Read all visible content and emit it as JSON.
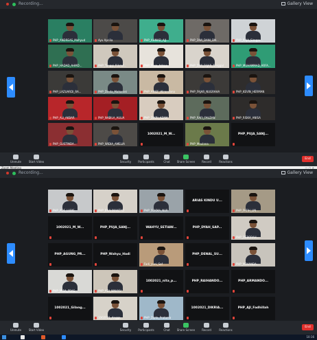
{
  "window_top": {
    "recording_label": "Recording...",
    "view_label": "Gallery View",
    "tiles": [
      {
        "name": "PHP_ANDREAS_Mahyud",
        "kind": "video",
        "bg": "#2a7f62"
      },
      {
        "name": "Ayu Aprilia",
        "kind": "video",
        "bg": "#4c4a48"
      },
      {
        "name": "PHP_AHMAD_AJJ...",
        "kind": "video",
        "bg": "#3fae8d"
      },
      {
        "name": "PHP_DWI_DANI_DN...",
        "kind": "video",
        "bg": "#6e6a66"
      },
      {
        "name": "PHP_RAJA_Siregar...",
        "kind": "video",
        "bg": "#cfd3d6"
      },
      {
        "name": "PHP_HADAD_AHMD...",
        "kind": "video",
        "bg": "#2f6f52"
      },
      {
        "name": "PHP_Tunggi_Rikmd...",
        "kind": "video",
        "bg": "#cfc8bd"
      },
      {
        "name": "PHP_Resa_Adnan",
        "kind": "video",
        "bg": "#e7e3dc"
      },
      {
        "name": "PHP_DWI_FAJAR_Tanggal",
        "kind": "video",
        "bg": "#d9d4cc"
      },
      {
        "name": "PHP_MUHAMMAD_ARFA...",
        "kind": "video",
        "bg": "#2f9c75"
      },
      {
        "name": "PHP_LAZUARDI_RA...",
        "kind": "video",
        "bg": "#3b3a38"
      },
      {
        "name": "PHP_Dinda_Maharani",
        "kind": "video",
        "bg": "#7a8a86"
      },
      {
        "name": "PHP_ARIEF_Wirandana",
        "kind": "video",
        "bg": "#c9b9a3"
      },
      {
        "name": "PHP_FAJAR_NUGRAHA",
        "kind": "video",
        "bg": "#3c3a38"
      },
      {
        "name": "PHP_KEVIN_HERMAN",
        "kind": "video",
        "bg": "#2f2d2c"
      },
      {
        "name": "PHP_ALI_AKBAR",
        "kind": "video",
        "bg": "#b8262a"
      },
      {
        "name": "PHP_NABILA_AULIA",
        "kind": "video",
        "bg": "#a41f24"
      },
      {
        "name": "PHP_DIKRI_AZAM",
        "kind": "video",
        "bg": "#d8ccbf"
      },
      {
        "name": "PHP_RAFI_FAUZAN",
        "kind": "video",
        "bg": "#5d6b5c"
      },
      {
        "name": "PHP_RISKA_ANISA",
        "kind": "video",
        "bg": "#2e2c2b"
      },
      {
        "name": "PHP_GUSTINDA...",
        "kind": "video",
        "bg": "#8b2f32"
      },
      {
        "name": "PHP_WIDIA_AMELIA",
        "kind": "video",
        "bg": "#4d4a47"
      },
      {
        "name": "1002021_M_W...",
        "kind": "name"
      },
      {
        "name": "PHP_Maulana",
        "kind": "video",
        "bg": "#6b7a4a"
      },
      {
        "name": "PHP_PUJA_SANJ...",
        "kind": "name"
      }
    ],
    "toolbar": [
      "Unmute",
      "Start Video",
      "Security",
      "Participants",
      "Chat",
      "Share Screen",
      "Record",
      "Reactions"
    ],
    "end_label": "End"
  },
  "app_title": "Zoom Meeting",
  "window_bottom": {
    "recording_label": "Recording...",
    "view_label": "Gallery View",
    "tiles": [
      {
        "name": "PHP_ADE_LUBIS",
        "kind": "video",
        "bg": "#c7c9cb"
      },
      {
        "name": "PHP_BRAHMANTYO",
        "kind": "video",
        "bg": "#d6d1c9"
      },
      {
        "name": "PHP_SUKMA_NUR",
        "kind": "video",
        "bg": "#9aa3a9"
      },
      {
        "name": "ARIAS KINDU U...",
        "kind": "name"
      },
      {
        "name": "PHP_FATIH_LIN...",
        "kind": "video",
        "bg": "#a59a86"
      },
      {
        "name": "1002021_M_W...",
        "kind": "name"
      },
      {
        "name": "PHP_PUJA_SANJ...",
        "kind": "name"
      },
      {
        "name": "WAHYU_SETIAW...",
        "kind": "name"
      },
      {
        "name": "PHP_DYAH_SAP...",
        "kind": "name"
      },
      {
        "name": "PHP_DEBORAH...",
        "kind": "video",
        "bg": "#d0cbc3"
      },
      {
        "name": "PHP_AGUNG_PR...",
        "kind": "name"
      },
      {
        "name": "PHP_Wahyu_Hadi",
        "kind": "name"
      },
      {
        "name": "Fadi_yuni_Saf",
        "kind": "video",
        "bg": "#b99b7a"
      },
      {
        "name": "PHP_DENAL_SU...",
        "kind": "name"
      },
      {
        "name": "PHP_NOVANDA...",
        "kind": "video",
        "bg": "#c8c4bc"
      },
      {
        "name": "PHP_MIRA_PRAS",
        "kind": "video",
        "bg": "#d9d9d6"
      },
      {
        "name": "PHP_ADI_WAHYU",
        "kind": "video",
        "bg": "#cdc6ba"
      },
      {
        "name": "1002021_nita_p...",
        "kind": "name"
      },
      {
        "name": "PHP_RAIHANDO...",
        "kind": "name"
      },
      {
        "name": "PHP_ARMANDO...",
        "kind": "name"
      },
      {
        "name": "1002021_Gilang...",
        "kind": "name"
      },
      {
        "name": "1002021_Angga",
        "kind": "video",
        "bg": "#d7d2c9"
      },
      {
        "name": "PHP_Dipta_Pratama",
        "kind": "video",
        "bg": "#9fb8c9"
      },
      {
        "name": "1002021_DIKRIA...",
        "kind": "name"
      },
      {
        "name": "PHP_AJI_Fadhillah",
        "kind": "name"
      }
    ],
    "toolbar": [
      "Unmute",
      "Start Video",
      "Security",
      "Participants",
      "Chat",
      "Share Screen",
      "Record",
      "Reactions"
    ],
    "end_label": "End",
    "taskbar_clock": "10:16"
  }
}
